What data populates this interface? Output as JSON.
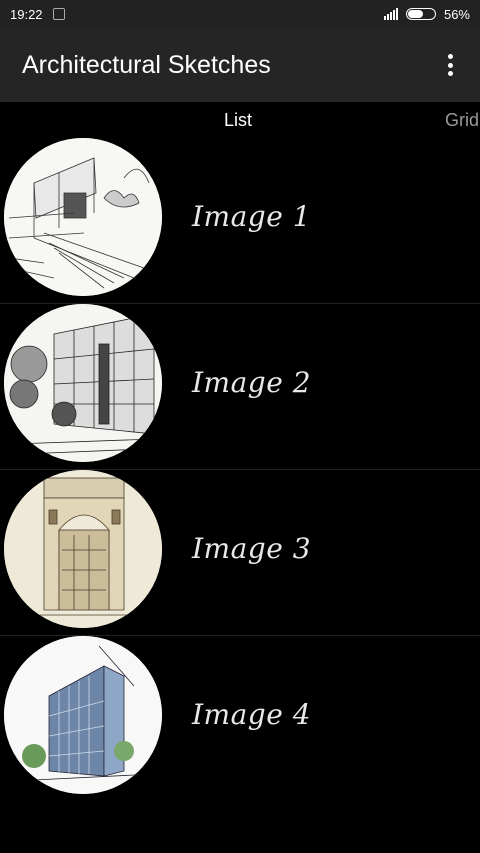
{
  "status_bar": {
    "time": "19:22",
    "battery_percent": "56%",
    "battery_level": 0.56,
    "icons": [
      "notification-icon",
      "signal-icon",
      "battery-icon"
    ]
  },
  "app_bar": {
    "title": "Architectural Sketches",
    "menu_icon": "overflow-menu-icon"
  },
  "tabs": [
    {
      "label": "List",
      "selected": true
    },
    {
      "label": "Grid",
      "selected": false
    }
  ],
  "list": {
    "items": [
      {
        "label": "Image 1"
      },
      {
        "label": "Image 2"
      },
      {
        "label": "Image 3"
      },
      {
        "label": "Image 4"
      }
    ]
  },
  "colors": {
    "background": "#000000",
    "app_bar": "#252525",
    "status_bar": "#222222",
    "tab_selected": "#ffffff",
    "tab_unselected": "#999999"
  }
}
